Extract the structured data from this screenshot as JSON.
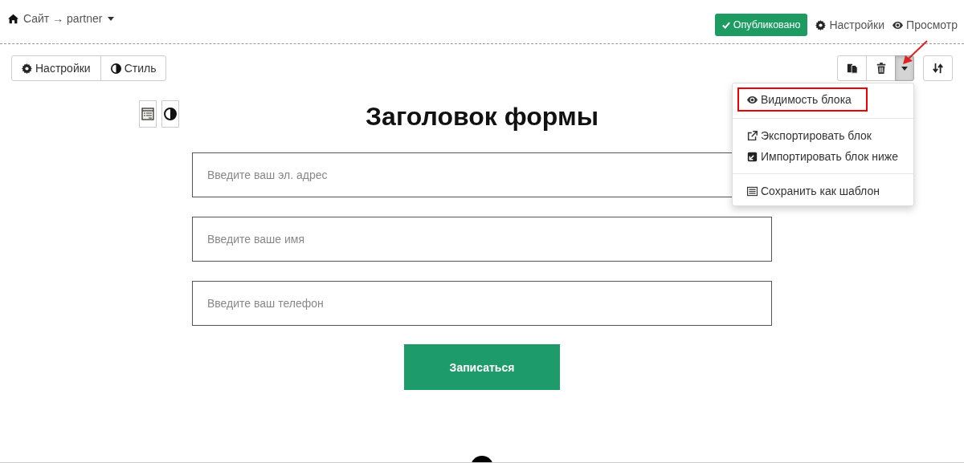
{
  "breadcrumb": {
    "label": "Сайт → partner"
  },
  "header_actions": {
    "status": {
      "label": "Опубликовано",
      "published": true
    },
    "links": [
      {
        "label": "Настройки",
        "kind": "settings"
      },
      {
        "label": "Просмотр",
        "kind": "preview"
      }
    ]
  },
  "block_toolbar": {
    "left": [
      {
        "label": "Настройки",
        "kind": "settings"
      },
      {
        "label": "Стиль",
        "kind": "style"
      }
    ],
    "right": [
      {
        "kind": "copy",
        "expanded": false
      },
      {
        "kind": "delete",
        "expanded": false
      },
      {
        "kind": "more",
        "expanded": true
      }
    ],
    "order": {
      "kind": "sort"
    }
  },
  "dropdown_menu": {
    "sections": [
      [
        {
          "label": "Видимость блока",
          "kind": "visibility",
          "highlighted": true
        }
      ],
      [
        {
          "label": "Экспортировать блок",
          "kind": "export",
          "highlighted": false
        },
        {
          "label": "Импортировать блок ниже",
          "kind": "import",
          "highlighted": false
        }
      ],
      [
        {
          "label": "Сохранить как шаблон",
          "kind": "template",
          "highlighted": false
        }
      ]
    ]
  },
  "side_tools": [
    {
      "kind": "form"
    },
    {
      "kind": "contrast"
    }
  ],
  "form": {
    "heading": "Заголовок формы",
    "fields": [
      {
        "placeholder": "Введите ваш эл. адрес"
      },
      {
        "placeholder": "Введите ваше имя"
      },
      {
        "placeholder": "Введите ваш телефон"
      }
    ],
    "submit": "Записаться"
  }
}
